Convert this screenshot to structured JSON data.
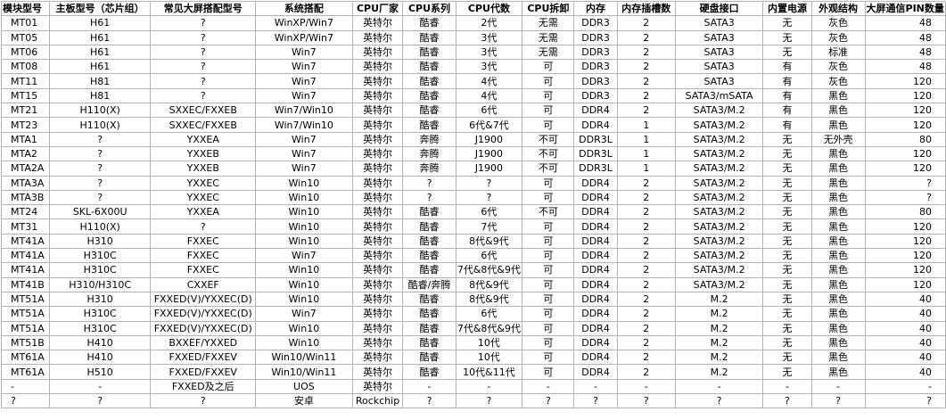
{
  "table": {
    "headers": [
      "模块型号",
      "主板型号（芯片组）",
      "常见大屏搭配型号",
      "系统搭配",
      "CPU厂家",
      "CPU系列",
      "CPU代数",
      "CPU拆卸",
      "内存",
      "内存插槽数",
      "硬盘接口",
      "内置电源",
      "外观结构",
      "大屏通信PIN数量"
    ],
    "rows": [
      [
        "MT01",
        "H61",
        "?",
        "WinXP/Win7",
        "英特尔",
        "酷睿",
        "2代",
        "无需",
        "DDR3",
        "2",
        "SATA3",
        "无",
        "灰色",
        "48"
      ],
      [
        "MT05",
        "H61",
        "?",
        "WinXP/Win7",
        "英特尔",
        "酷睿",
        "3代",
        "无需",
        "DDR3",
        "2",
        "SATA3",
        "无",
        "灰色",
        "48"
      ],
      [
        "MT06",
        "H61",
        "?",
        "Win7",
        "英特尔",
        "酷睿",
        "3代",
        "无需",
        "DDR3",
        "2",
        "SATA3",
        "无",
        "标准",
        "48"
      ],
      [
        "MT08",
        "H61",
        "?",
        "Win7",
        "英特尔",
        "酷睿",
        "3代",
        "可",
        "DDR3",
        "2",
        "SATA3",
        "有",
        "灰色",
        "48"
      ],
      [
        "MT11",
        "H81",
        "?",
        "Win7",
        "英特尔",
        "酷睿",
        "4代",
        "可",
        "DDR3",
        "2",
        "SATA3",
        "有",
        "灰色",
        "120"
      ],
      [
        "MT15",
        "H81",
        "?",
        "Win7",
        "英特尔",
        "酷睿",
        "4代",
        "可",
        "DDR3",
        "2",
        "SATA3/mSATA",
        "有",
        "黑色",
        "120"
      ],
      [
        "MT21",
        "H110(X)",
        "SXXEC/FXXEB",
        "Win7/Win10",
        "英特尔",
        "酷睿",
        "6代",
        "可",
        "DDR4",
        "2",
        "SATA3/M.2",
        "有",
        "黑色",
        "120"
      ],
      [
        "MT23",
        "H110(X)",
        "SXXEC/FXXEB",
        "Win7/Win10",
        "英特尔",
        "酷睿",
        "6代&7代",
        "可",
        "DDR4",
        "1",
        "SATA3/M.2",
        "有",
        "黑色",
        "120"
      ],
      [
        "MTA1",
        "?",
        "YXXEA",
        "Win7",
        "英特尔",
        "奔腾",
        "J1900",
        "不可",
        "DDR3L",
        "1",
        "SATA3/M.2",
        "无",
        "无外壳",
        "80"
      ],
      [
        "MTA2",
        "?",
        "YXXEB",
        "Win7",
        "英特尔",
        "奔腾",
        "J1900",
        "不可",
        "DDR3L",
        "1",
        "SATA3/M.2",
        "无",
        "黑色",
        "120"
      ],
      [
        "MTA2A",
        "?",
        "YXXEB",
        "Win7",
        "英特尔",
        "奔腾",
        "J1900",
        "不可",
        "DDR3L",
        "1",
        "SATA3/M.2",
        "无",
        "黑色",
        "120"
      ],
      [
        "MTA3A",
        "?",
        "YXXEC",
        "Win10",
        "英特尔",
        "?",
        "?",
        "可",
        "DDR4",
        "2",
        "SATA3/M.2",
        "无",
        "黑色",
        "?"
      ],
      [
        "MTA3B",
        "?",
        "YXXEC",
        "Win10",
        "英特尔",
        "?",
        "?",
        "可",
        "DDR4",
        "2",
        "SATA3/M.2",
        "无",
        "黑色",
        "?"
      ],
      [
        "MT24",
        "SKL-6X00U",
        "YXXEA",
        "Win10",
        "英特尔",
        "酷睿",
        "6代",
        "不可",
        "DDR4",
        "2",
        "SATA3/M.2",
        "无",
        "黑色",
        "80"
      ],
      [
        "MT31",
        "H110(X)",
        "?",
        "Win10",
        "英特尔",
        "酷睿",
        "7代",
        "可",
        "DDR4",
        "2",
        "SATA3/M.2",
        "无",
        "黑色",
        "120"
      ],
      [
        "MT41A",
        "H310",
        "FXXEC",
        "Win10",
        "英特尔",
        "酷睿",
        "8代&9代",
        "可",
        "DDR4",
        "2",
        "SATA3/M.2",
        "无",
        "黑色",
        "120"
      ],
      [
        "MT41A",
        "H310C",
        "FXXEC",
        "Win7",
        "英特尔",
        "酷睿",
        "6代",
        "可",
        "DDR4",
        "2",
        "SATA3/M.2",
        "无",
        "黑色",
        "120"
      ],
      [
        "MT41A",
        "H310C",
        "FXXEC",
        "Win10",
        "英特尔",
        "酷睿",
        "7代&8代&9代",
        "可",
        "DDR4",
        "2",
        "SATA3/M.2",
        "无",
        "黑色",
        "120"
      ],
      [
        "MT41B",
        "H310/H310C",
        "CXXEF",
        "Win10",
        "英特尔",
        "酷睿/奔腾",
        "8代&9代",
        "可",
        "DDR4",
        "2",
        "SATA3/M.2",
        "无",
        "黑色",
        "120"
      ],
      [
        "MT51A",
        "H310",
        "FXXED(V)/YXXEC(D)",
        "Win10",
        "英特尔",
        "酷睿",
        "8代&9代",
        "可",
        "DDR4",
        "2",
        "M.2",
        "无",
        "黑色",
        "40"
      ],
      [
        "MT51A",
        "H310C",
        "FXXED(V)/YXXEC(D)",
        "Win7",
        "英特尔",
        "酷睿",
        "6代",
        "可",
        "DDR4",
        "2",
        "M.2",
        "无",
        "黑色",
        "40"
      ],
      [
        "MT51A",
        "H310C",
        "FXXED(V)/YXXEC(D)",
        "Win10",
        "英特尔",
        "酷睿",
        "7代&8代&9代",
        "可",
        "DDR4",
        "2",
        "M.2",
        "无",
        "黑色",
        "40"
      ],
      [
        "MT51B",
        "H410",
        "BXXEF/YXXED",
        "Win10",
        "英特尔",
        "酷睿",
        "10代",
        "可",
        "DDR4",
        "2",
        "M.2",
        "无",
        "黑色",
        "40"
      ],
      [
        "MT61A",
        "H410",
        "FXXED/FXXEV",
        "Win10/Win11",
        "英特尔",
        "酷睿",
        "10代",
        "可",
        "DDR4",
        "2",
        "M.2",
        "无",
        "黑色",
        "40"
      ],
      [
        "MT61A",
        "H510",
        "FXXED/FXXEV",
        "Win10/Win11",
        "英特尔",
        "酷睿",
        "10代&11代",
        "可",
        "DDR4",
        "2",
        "M.2",
        "无",
        "黑色",
        "40"
      ],
      [
        "-",
        "-",
        "FXXED及之后",
        "UOS",
        "英特尔",
        "-",
        "-",
        "-",
        "-",
        "-",
        "-",
        "-",
        "-",
        "-"
      ],
      [
        "?",
        "?",
        "?",
        "安卓",
        "Rockchip",
        "?",
        "?",
        "?",
        "?",
        "?",
        "?",
        "?",
        "?",
        "?"
      ]
    ]
  }
}
